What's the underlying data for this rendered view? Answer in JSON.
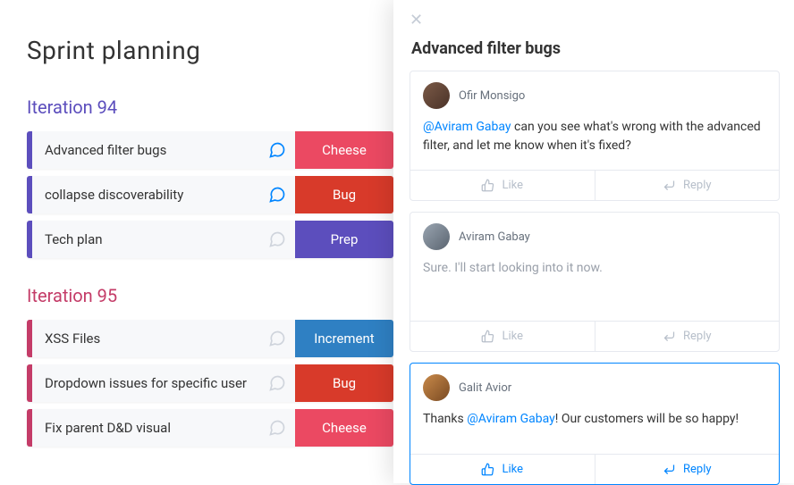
{
  "page_title": "Sprint planning",
  "iterations": [
    {
      "title": "Iteration 94",
      "color": "purple",
      "rows": [
        {
          "title": "Advanced filter bugs",
          "chat": true,
          "tag": "Cheese",
          "tag_kind": "cheese"
        },
        {
          "title": "collapse discoverability",
          "chat": true,
          "tag": "Bug",
          "tag_kind": "bug"
        },
        {
          "title": "Tech plan",
          "chat": false,
          "tag": "Prep",
          "tag_kind": "prep"
        }
      ]
    },
    {
      "title": "Iteration 95",
      "color": "red",
      "rows": [
        {
          "title": "XSS Files",
          "chat": false,
          "tag": "Increment",
          "tag_kind": "inc"
        },
        {
          "title": "Dropdown issues for specific user",
          "chat": false,
          "tag": "Bug",
          "tag_kind": "bug"
        },
        {
          "title": "Fix parent D&D visual",
          "chat": false,
          "tag": "Cheese",
          "tag_kind": "cheese"
        }
      ]
    }
  ],
  "panel": {
    "title": "Advanced filter bugs",
    "like_label": "Like",
    "reply_label": "Reply",
    "comments": [
      {
        "author": "Ofir Monsigo",
        "avatar": "av1",
        "mention": "@Aviram Gabay",
        "text": " can you see what's wrong with the advanced filter, and let me know when it's fixed?",
        "muted": false,
        "focus": false
      },
      {
        "author": "Aviram Gabay",
        "avatar": "av2",
        "mention": "",
        "text": "Sure. I'll start looking into it now.",
        "muted": true,
        "focus": false
      },
      {
        "author": "Galit Avior",
        "avatar": "av3",
        "pre": "Thanks ",
        "mention": "@Aviram Gabay",
        "text": "! Our customers will be so happy!",
        "muted": false,
        "focus": true
      }
    ]
  }
}
